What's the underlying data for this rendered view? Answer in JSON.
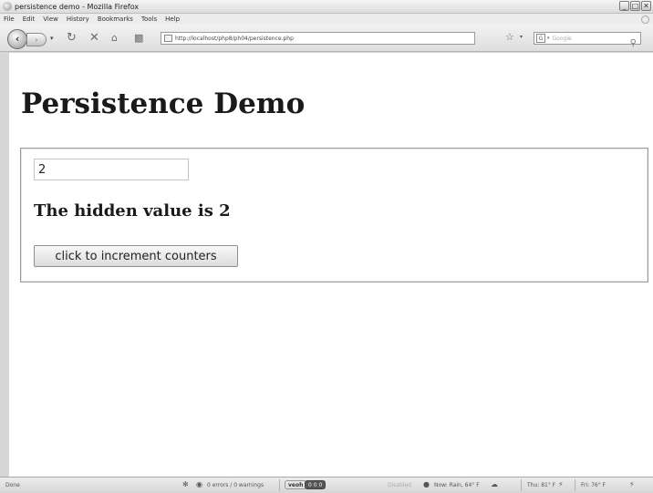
{
  "window": {
    "title": "persistence demo - Mozilla Firefox",
    "buttons": {
      "minimize": "_",
      "maximize": "□",
      "close": "✕"
    }
  },
  "menu": [
    "File",
    "Edit",
    "View",
    "History",
    "Bookmarks",
    "Tools",
    "Help"
  ],
  "nav": {
    "url": "http://localhost/php8/ph04/persistence.php",
    "search_placeholder": "Google",
    "search_engine": "G"
  },
  "page": {
    "heading": "Persistence Demo",
    "input_value": "2",
    "hidden_message": "The hidden value is 2",
    "button_label": "click to increment counters"
  },
  "status": {
    "left": "Done",
    "errors": "0 errors / 0 warnings",
    "veoh": "veoh",
    "veoh_counter": "0 0 0",
    "disabled": "Disabled",
    "weather_now": "Now: Rain, 64° F",
    "weather_thu": "Thu: 81° F",
    "weather_fri": "Fri: 76° F"
  }
}
